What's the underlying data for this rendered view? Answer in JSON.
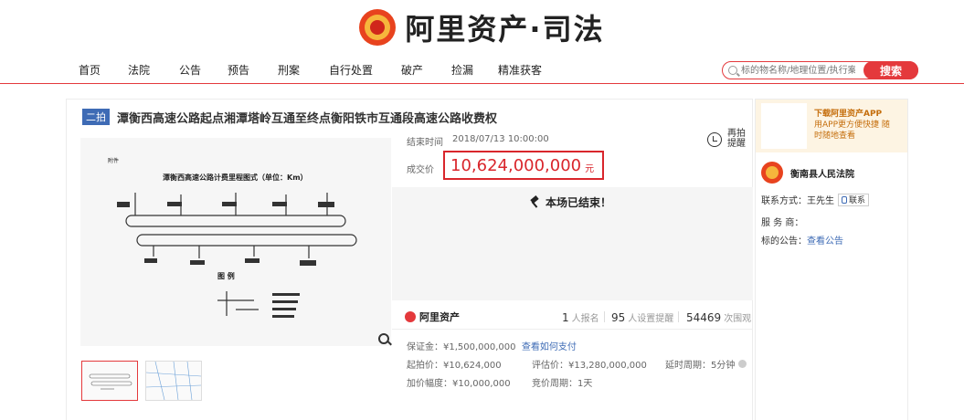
{
  "header": {
    "logo_text": "阿里资产·司法"
  },
  "nav": {
    "items": [
      {
        "label": "首页"
      },
      {
        "label": "法院"
      },
      {
        "label": "公告"
      },
      {
        "label": "预告"
      },
      {
        "label": "刑案"
      },
      {
        "label": "自行处置"
      },
      {
        "label": "破产"
      },
      {
        "label": "捡漏"
      },
      {
        "label": "精准获客"
      }
    ],
    "search_placeholder": "标的物名称/地理位置/执行案号",
    "search_button": "搜索"
  },
  "auction": {
    "badge": "二拍",
    "title": "潭衡西高速公路起点湘潭塔岭互通至终点衡阳铁市互通段高速公路收费权",
    "doc_label": "附件",
    "doc_title": "潭衡西高速公路计费里程图式（单位：Km）",
    "doc_legend_title": "图 例",
    "end_time_label": "结束时间",
    "end_time": "2018/07/13 10:00:00",
    "remind_label": "再拍提醒",
    "deal_label": "成交价",
    "deal_price": "10,624,000,000",
    "deal_unit": "元",
    "ended_text": "本场已结束！",
    "platform_name": "阿里资产",
    "signups": "1",
    "signups_label": "人报名",
    "reminders": "95",
    "reminders_label": "人设置提醒",
    "views": "54469",
    "views_label": "次围观",
    "deposit": "保证金：¥1,500,000,000",
    "deposit_link": "查看如何支付",
    "start_price": "起拍价：¥10,624,000",
    "assessed_price": "评估价：¥13,280,000,000",
    "delay_period": "延时周期：5分钟",
    "increment": "加价幅度：¥10,000,000",
    "bid_period": "竞价周期：1天"
  },
  "side": {
    "app_title": "下载阿里资产APP",
    "app_desc": "用APP更方便快捷 随时随地查看",
    "court_name": "衡南县人民法院",
    "contact_label": "联系方式：",
    "contact_name": "王先生",
    "contact_button": "联系",
    "service_label": "服 务 商：",
    "notice_label": "标的公告：",
    "notice_link": "查看公告"
  }
}
